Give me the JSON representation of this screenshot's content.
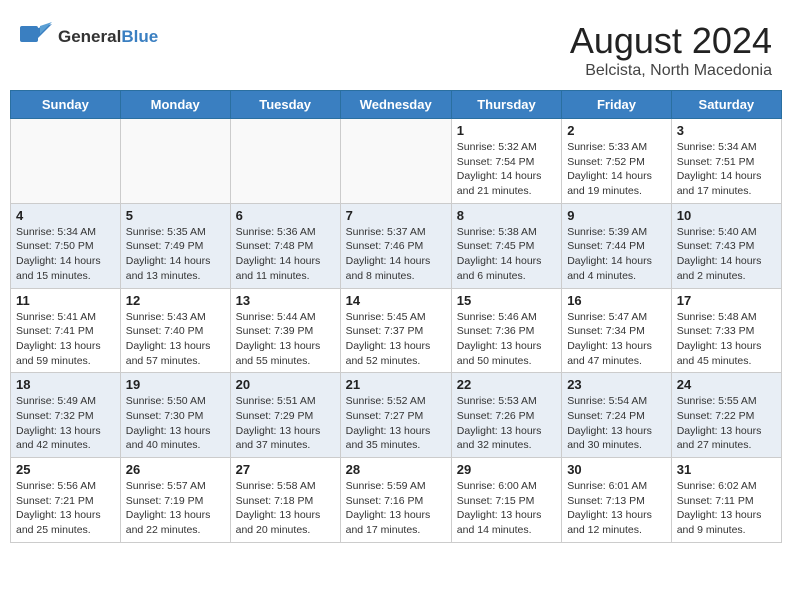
{
  "header": {
    "logo_general": "General",
    "logo_blue": "Blue",
    "month_year": "August 2024",
    "location": "Belcista, North Macedonia"
  },
  "days_of_week": [
    "Sunday",
    "Monday",
    "Tuesday",
    "Wednesday",
    "Thursday",
    "Friday",
    "Saturday"
  ],
  "weeks": [
    [
      {
        "day": "",
        "info": ""
      },
      {
        "day": "",
        "info": ""
      },
      {
        "day": "",
        "info": ""
      },
      {
        "day": "",
        "info": ""
      },
      {
        "day": "1",
        "info": "Sunrise: 5:32 AM\nSunset: 7:54 PM\nDaylight: 14 hours\nand 21 minutes."
      },
      {
        "day": "2",
        "info": "Sunrise: 5:33 AM\nSunset: 7:52 PM\nDaylight: 14 hours\nand 19 minutes."
      },
      {
        "day": "3",
        "info": "Sunrise: 5:34 AM\nSunset: 7:51 PM\nDaylight: 14 hours\nand 17 minutes."
      }
    ],
    [
      {
        "day": "4",
        "info": "Sunrise: 5:34 AM\nSunset: 7:50 PM\nDaylight: 14 hours\nand 15 minutes."
      },
      {
        "day": "5",
        "info": "Sunrise: 5:35 AM\nSunset: 7:49 PM\nDaylight: 14 hours\nand 13 minutes."
      },
      {
        "day": "6",
        "info": "Sunrise: 5:36 AM\nSunset: 7:48 PM\nDaylight: 14 hours\nand 11 minutes."
      },
      {
        "day": "7",
        "info": "Sunrise: 5:37 AM\nSunset: 7:46 PM\nDaylight: 14 hours\nand 8 minutes."
      },
      {
        "day": "8",
        "info": "Sunrise: 5:38 AM\nSunset: 7:45 PM\nDaylight: 14 hours\nand 6 minutes."
      },
      {
        "day": "9",
        "info": "Sunrise: 5:39 AM\nSunset: 7:44 PM\nDaylight: 14 hours\nand 4 minutes."
      },
      {
        "day": "10",
        "info": "Sunrise: 5:40 AM\nSunset: 7:43 PM\nDaylight: 14 hours\nand 2 minutes."
      }
    ],
    [
      {
        "day": "11",
        "info": "Sunrise: 5:41 AM\nSunset: 7:41 PM\nDaylight: 13 hours\nand 59 minutes."
      },
      {
        "day": "12",
        "info": "Sunrise: 5:43 AM\nSunset: 7:40 PM\nDaylight: 13 hours\nand 57 minutes."
      },
      {
        "day": "13",
        "info": "Sunrise: 5:44 AM\nSunset: 7:39 PM\nDaylight: 13 hours\nand 55 minutes."
      },
      {
        "day": "14",
        "info": "Sunrise: 5:45 AM\nSunset: 7:37 PM\nDaylight: 13 hours\nand 52 minutes."
      },
      {
        "day": "15",
        "info": "Sunrise: 5:46 AM\nSunset: 7:36 PM\nDaylight: 13 hours\nand 50 minutes."
      },
      {
        "day": "16",
        "info": "Sunrise: 5:47 AM\nSunset: 7:34 PM\nDaylight: 13 hours\nand 47 minutes."
      },
      {
        "day": "17",
        "info": "Sunrise: 5:48 AM\nSunset: 7:33 PM\nDaylight: 13 hours\nand 45 minutes."
      }
    ],
    [
      {
        "day": "18",
        "info": "Sunrise: 5:49 AM\nSunset: 7:32 PM\nDaylight: 13 hours\nand 42 minutes."
      },
      {
        "day": "19",
        "info": "Sunrise: 5:50 AM\nSunset: 7:30 PM\nDaylight: 13 hours\nand 40 minutes."
      },
      {
        "day": "20",
        "info": "Sunrise: 5:51 AM\nSunset: 7:29 PM\nDaylight: 13 hours\nand 37 minutes."
      },
      {
        "day": "21",
        "info": "Sunrise: 5:52 AM\nSunset: 7:27 PM\nDaylight: 13 hours\nand 35 minutes."
      },
      {
        "day": "22",
        "info": "Sunrise: 5:53 AM\nSunset: 7:26 PM\nDaylight: 13 hours\nand 32 minutes."
      },
      {
        "day": "23",
        "info": "Sunrise: 5:54 AM\nSunset: 7:24 PM\nDaylight: 13 hours\nand 30 minutes."
      },
      {
        "day": "24",
        "info": "Sunrise: 5:55 AM\nSunset: 7:22 PM\nDaylight: 13 hours\nand 27 minutes."
      }
    ],
    [
      {
        "day": "25",
        "info": "Sunrise: 5:56 AM\nSunset: 7:21 PM\nDaylight: 13 hours\nand 25 minutes."
      },
      {
        "day": "26",
        "info": "Sunrise: 5:57 AM\nSunset: 7:19 PM\nDaylight: 13 hours\nand 22 minutes."
      },
      {
        "day": "27",
        "info": "Sunrise: 5:58 AM\nSunset: 7:18 PM\nDaylight: 13 hours\nand 20 minutes."
      },
      {
        "day": "28",
        "info": "Sunrise: 5:59 AM\nSunset: 7:16 PM\nDaylight: 13 hours\nand 17 minutes."
      },
      {
        "day": "29",
        "info": "Sunrise: 6:00 AM\nSunset: 7:15 PM\nDaylight: 13 hours\nand 14 minutes."
      },
      {
        "day": "30",
        "info": "Sunrise: 6:01 AM\nSunset: 7:13 PM\nDaylight: 13 hours\nand 12 minutes."
      },
      {
        "day": "31",
        "info": "Sunrise: 6:02 AM\nSunset: 7:11 PM\nDaylight: 13 hours\nand 9 minutes."
      }
    ]
  ]
}
